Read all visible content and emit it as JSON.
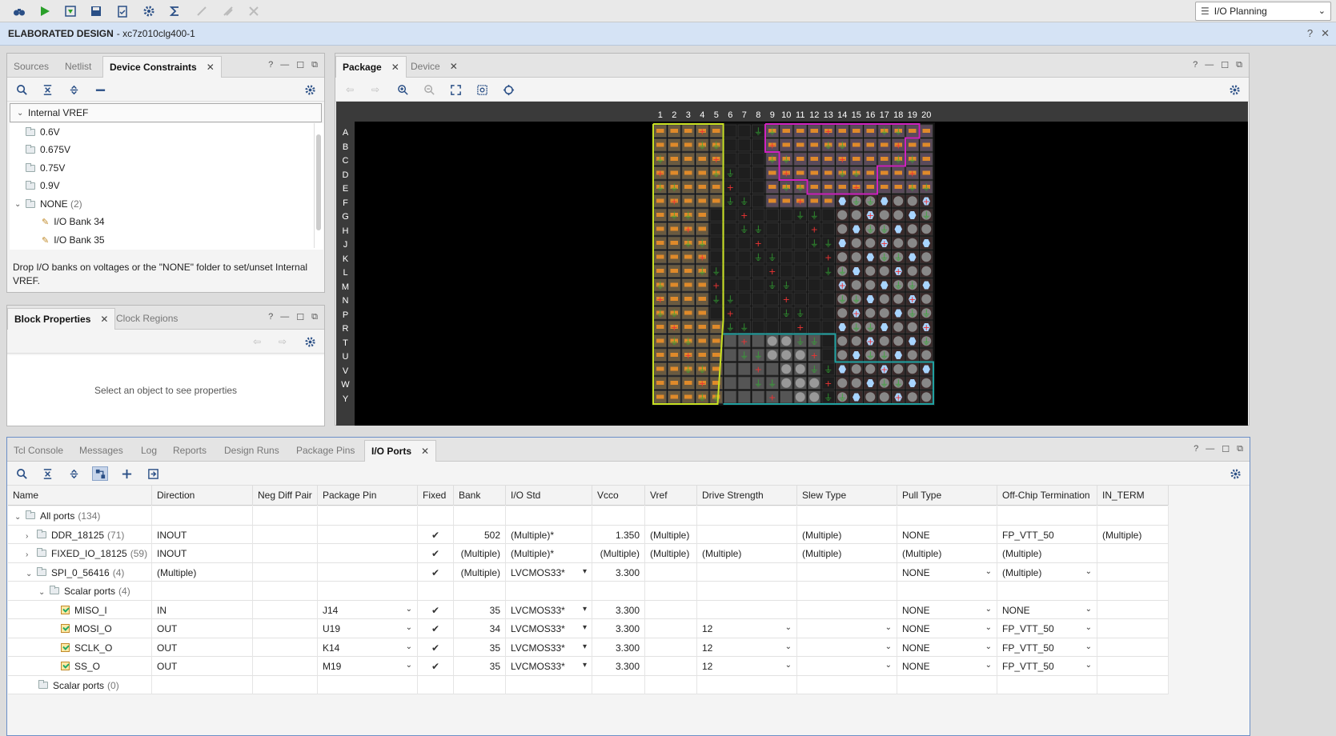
{
  "toolbar": {
    "layout_selector": "I/O Planning"
  },
  "design": {
    "title": "ELABORATED DESIGN",
    "part": "- xc7z010clg400-1"
  },
  "constraints_panel": {
    "tabs": [
      {
        "label": "Sources"
      },
      {
        "label": "Netlist"
      },
      {
        "label": "Device Constraints"
      }
    ],
    "header": "Internal VREF",
    "tree": [
      {
        "label": "0.6V"
      },
      {
        "label": "0.675V"
      },
      {
        "label": "0.75V"
      },
      {
        "label": "0.9V"
      },
      {
        "label": "NONE",
        "count": "(2)"
      },
      {
        "label": "I/O Bank 34"
      },
      {
        "label": "I/O Bank 35"
      }
    ],
    "hint": "Drop I/O banks on voltages or the \"NONE\" folder to set/unset Internal VREF."
  },
  "block_panel": {
    "tabs": [
      {
        "label": "Block Properties"
      },
      {
        "label": "Clock Regions"
      }
    ],
    "empty_text": "Select an object to see properties"
  },
  "package_panel": {
    "tabs": [
      {
        "label": "Package"
      },
      {
        "label": "Device"
      }
    ],
    "columns": [
      "1",
      "2",
      "3",
      "4",
      "5",
      "6",
      "7",
      "8",
      "9",
      "10",
      "11",
      "12",
      "13",
      "14",
      "15",
      "16",
      "17",
      "18",
      "19",
      "20"
    ],
    "rows": [
      "A",
      "B",
      "C",
      "D",
      "E",
      "F",
      "G",
      "H",
      "J",
      "K",
      "L",
      "M",
      "N",
      "P",
      "R",
      "T",
      "U",
      "V",
      "W",
      "Y"
    ],
    "colors": {
      "bank_yellow": "#c8e020",
      "bank_magenta": "#d020c0",
      "bank_teal": "#20a0a0",
      "pin_orange": "#e08a2a"
    }
  },
  "bottom_panel": {
    "tabs": [
      {
        "label": "Tcl Console"
      },
      {
        "label": "Messages"
      },
      {
        "label": "Log"
      },
      {
        "label": "Reports"
      },
      {
        "label": "Design Runs"
      },
      {
        "label": "Package Pins"
      },
      {
        "label": "I/O Ports"
      }
    ],
    "columns": [
      "Name",
      "Direction",
      "Neg Diff Pair",
      "Package Pin",
      "Fixed",
      "Bank",
      "I/O Std",
      "Vcco",
      "Vref",
      "Drive Strength",
      "Slew Type",
      "Pull Type",
      "Off-Chip Termination",
      "IN_TERM"
    ],
    "rows": [
      {
        "name": "All ports",
        "count": "(134)",
        "direction": "",
        "pin": "",
        "fixed": "",
        "bank": "",
        "iostd": "",
        "vcco": "",
        "vref": "",
        "drive": "",
        "slew": "",
        "pull": "",
        "term": "",
        "interm": ""
      },
      {
        "name": "DDR_18125",
        "count": "(71)",
        "direction": "INOUT",
        "pin": "",
        "fixed": "✔",
        "bank": "502",
        "iostd": "(Multiple)*",
        "vcco": "1.350",
        "vref": "(Multiple)",
        "drive": "",
        "slew": "(Multiple)",
        "pull": "NONE",
        "term": "FP_VTT_50",
        "interm": "(Multiple)"
      },
      {
        "name": "FIXED_IO_18125",
        "count": "(59)",
        "direction": "INOUT",
        "pin": "",
        "fixed": "✔",
        "bank": "(Multiple)",
        "iostd": "(Multiple)*",
        "vcco": "(Multiple)",
        "vref": "(Multiple)",
        "drive": "(Multiple)",
        "slew": "(Multiple)",
        "pull": "(Multiple)",
        "term": "(Multiple)",
        "interm": ""
      },
      {
        "name": "SPI_0_56416",
        "count": "(4)",
        "direction": "(Multiple)",
        "pin": "",
        "fixed": "✔",
        "bank": "(Multiple)",
        "iostd": "LVCMOS33*",
        "vcco": "3.300",
        "vref": "",
        "drive": "",
        "slew": "",
        "pull": "NONE",
        "term": "(Multiple)",
        "interm": ""
      },
      {
        "name": "Scalar ports",
        "count": "(4)",
        "direction": "",
        "pin": "",
        "fixed": "",
        "bank": "",
        "iostd": "",
        "vcco": "",
        "vref": "",
        "drive": "",
        "slew": "",
        "pull": "",
        "term": "",
        "interm": ""
      },
      {
        "name": "MISO_I",
        "count": "",
        "direction": "IN",
        "pin": "J14",
        "fixed": "✔",
        "bank": "35",
        "iostd": "LVCMOS33*",
        "vcco": "3.300",
        "vref": "",
        "drive": "",
        "slew": "",
        "pull": "NONE",
        "term": "NONE",
        "interm": ""
      },
      {
        "name": "MOSI_O",
        "count": "",
        "direction": "OUT",
        "pin": "U19",
        "fixed": "✔",
        "bank": "34",
        "iostd": "LVCMOS33*",
        "vcco": "3.300",
        "vref": "",
        "drive": "12",
        "slew": "",
        "pull": "NONE",
        "term": "FP_VTT_50",
        "interm": ""
      },
      {
        "name": "SCLK_O",
        "count": "",
        "direction": "OUT",
        "pin": "K14",
        "fixed": "✔",
        "bank": "35",
        "iostd": "LVCMOS33*",
        "vcco": "3.300",
        "vref": "",
        "drive": "12",
        "slew": "",
        "pull": "NONE",
        "term": "FP_VTT_50",
        "interm": ""
      },
      {
        "name": "SS_O",
        "count": "",
        "direction": "OUT",
        "pin": "M19",
        "fixed": "✔",
        "bank": "35",
        "iostd": "LVCMOS33*",
        "vcco": "3.300",
        "vref": "",
        "drive": "12",
        "slew": "",
        "pull": "NONE",
        "term": "FP_VTT_50",
        "interm": ""
      },
      {
        "name": "Scalar ports",
        "count": "(0)",
        "direction": "",
        "pin": "",
        "fixed": "",
        "bank": "",
        "iostd": "",
        "vcco": "",
        "vref": "",
        "drive": "",
        "slew": "",
        "pull": "",
        "term": "",
        "interm": ""
      }
    ]
  }
}
